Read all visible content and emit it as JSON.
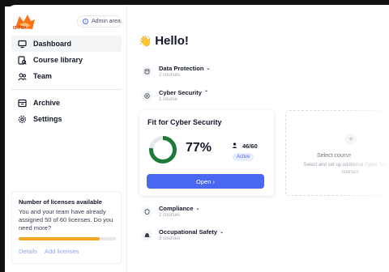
{
  "logo": {
    "text": "IS-FOX"
  },
  "admin": {
    "label": "Admin area"
  },
  "nav": {
    "items": [
      {
        "label": "Dashboard",
        "icon": "monitor-icon",
        "active": true
      },
      {
        "label": "Course library",
        "icon": "library-icon"
      },
      {
        "label": "Team",
        "icon": "team-icon"
      }
    ],
    "items2": [
      {
        "label": "Archive",
        "icon": "archive-icon"
      },
      {
        "label": "Settings",
        "icon": "gear-icon"
      }
    ]
  },
  "license": {
    "title": "Number of licenses available",
    "text": "You and your team have already assigned 50 of 60 licenses. Do you need more?",
    "used": 50,
    "total": 60,
    "details": "Details",
    "add": "Add licenses"
  },
  "greeting": {
    "emoji": "👋",
    "text": "Hello!"
  },
  "categories": [
    {
      "name": "Data Protection",
      "count": "2 courses",
      "expanded": false
    },
    {
      "name": "Cyber Security",
      "count": "1 course",
      "expanded": true
    },
    {
      "name": "Compliance",
      "count": "2 courses",
      "expanded": false
    },
    {
      "name": "Occupational Safety",
      "count": "3 courses",
      "expanded": false
    }
  ],
  "course": {
    "title": "Fit for Cyber Security",
    "percent": "77%",
    "percent_value": 77,
    "participants": "46/60",
    "status": "Active",
    "button": "Open ›"
  },
  "select_course": {
    "plus": "+",
    "title": "Select course",
    "subtitle": "Select and set up additional Cyber Security courses"
  },
  "colors": {
    "accent": "#4a67f0",
    "progress": "#f6a623",
    "ring": "#1e7a3a"
  }
}
